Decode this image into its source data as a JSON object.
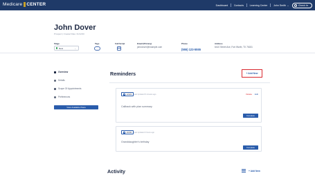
{
  "nav": {
    "brand_left": "Medicare",
    "brand_right": "CENTER",
    "links": [
      "Dashboard",
      "Contacts",
      "Learning Center"
    ],
    "user": "John Smith",
    "checkin": "Check In"
  },
  "contact": {
    "name": "John Dover",
    "created": "Prospect | Created Date: 01/12/20",
    "stage_label": "Stage",
    "stage_value": "New",
    "tags_label": "Tags",
    "callscript_label": "Call Script",
    "email_label": "Email (Primary)",
    "email_value": "johndover@example.com",
    "phone_label": "Phone",
    "phone_value": "(555) 123-5555",
    "address_label": "Address",
    "address_value": "6410 Street Ave, Fort Worth, TX 76151"
  },
  "sidebar": {
    "items": [
      {
        "label": "Overview",
        "active": true,
        "icon": "home-icon"
      },
      {
        "label": "Details",
        "active": false,
        "icon": "person-icon"
      },
      {
        "label": "Scope Of Appointments",
        "active": false,
        "icon": "calendar-icon"
      },
      {
        "label": "Preferences",
        "active": false,
        "icon": "gear-icon"
      }
    ],
    "view_plans": "View Available Plans"
  },
  "reminders": {
    "title": "Reminders",
    "add_new": "+ Add New",
    "items": [
      {
        "time": "12/22",
        "updated": "Last Updated 8 minutes ago",
        "text": "Callback with plan summary",
        "delete": "Delete",
        "edit": "Edit",
        "complete": "Complete"
      },
      {
        "time": "10/30",
        "updated": "Last Updated 3 hours ago",
        "text": "Granddaughter's birthday",
        "complete": "Complete"
      }
    ]
  },
  "activity": {
    "title": "Activity",
    "add_new": "+ Add New"
  },
  "colors": {
    "nav_bg": "#1f3a68",
    "accent": "#2a5cab",
    "highlight": "#d9272e",
    "gold": "#c9a227"
  }
}
